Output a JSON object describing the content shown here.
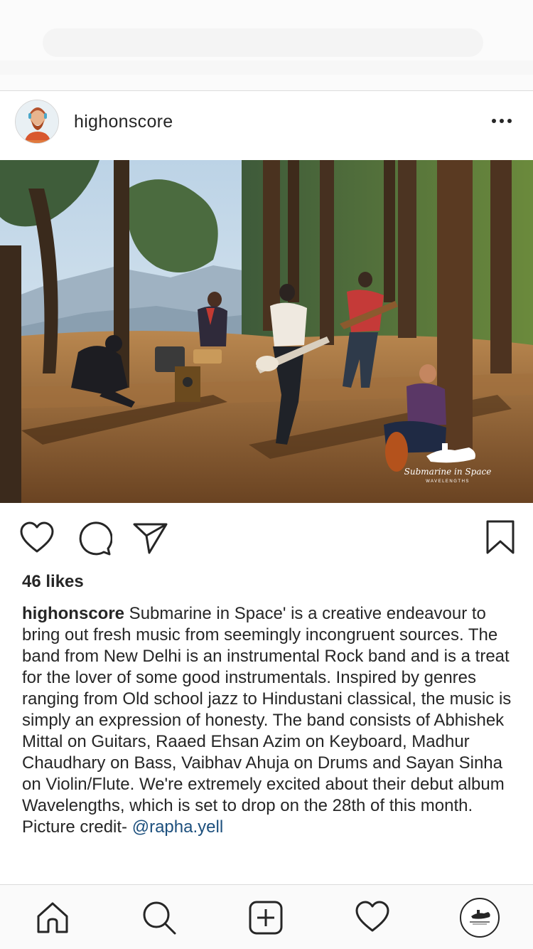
{
  "post": {
    "username": "highonscore",
    "likes": "46 likes",
    "caption_user": "highonscore",
    "caption_text": " Submarine in Space' is a creative endeavour to bring out fresh music from seemingly incongruent sources. The band from New Delhi is an instrumental Rock band and is a treat for the lover of some good instrumentals. Inspired by genres ranging from Old school jazz to Hindustani classical, the music is simply an expression of honesty. The band consists of Abhishek Mittal on Guitars, Raaed Ehsan Azim on Keyboard, Madhur Chaudhary on Bass, Vaibhav Ahuja on Drums and Sayan Sinha on Violin/Flute. We're extremely excited about their debut album Wavelengths, which is set to drop on the 28th of this month. Picture credit-",
    "mention": "@rapha.yell",
    "watermark_title": "Submarine in Space",
    "watermark_sub": "WAVELENGTHS"
  },
  "icons": {
    "more": "more-options-icon",
    "like": "heart-icon",
    "comment": "comment-icon",
    "share": "send-icon",
    "save": "bookmark-icon",
    "home": "home-icon",
    "search": "search-icon",
    "add": "add-post-icon",
    "activity": "heart-icon",
    "profile": "profile-avatar"
  },
  "colors": {
    "text": "#262626",
    "link": "#1c4f7d",
    "tab_bg": "#fafafa"
  }
}
